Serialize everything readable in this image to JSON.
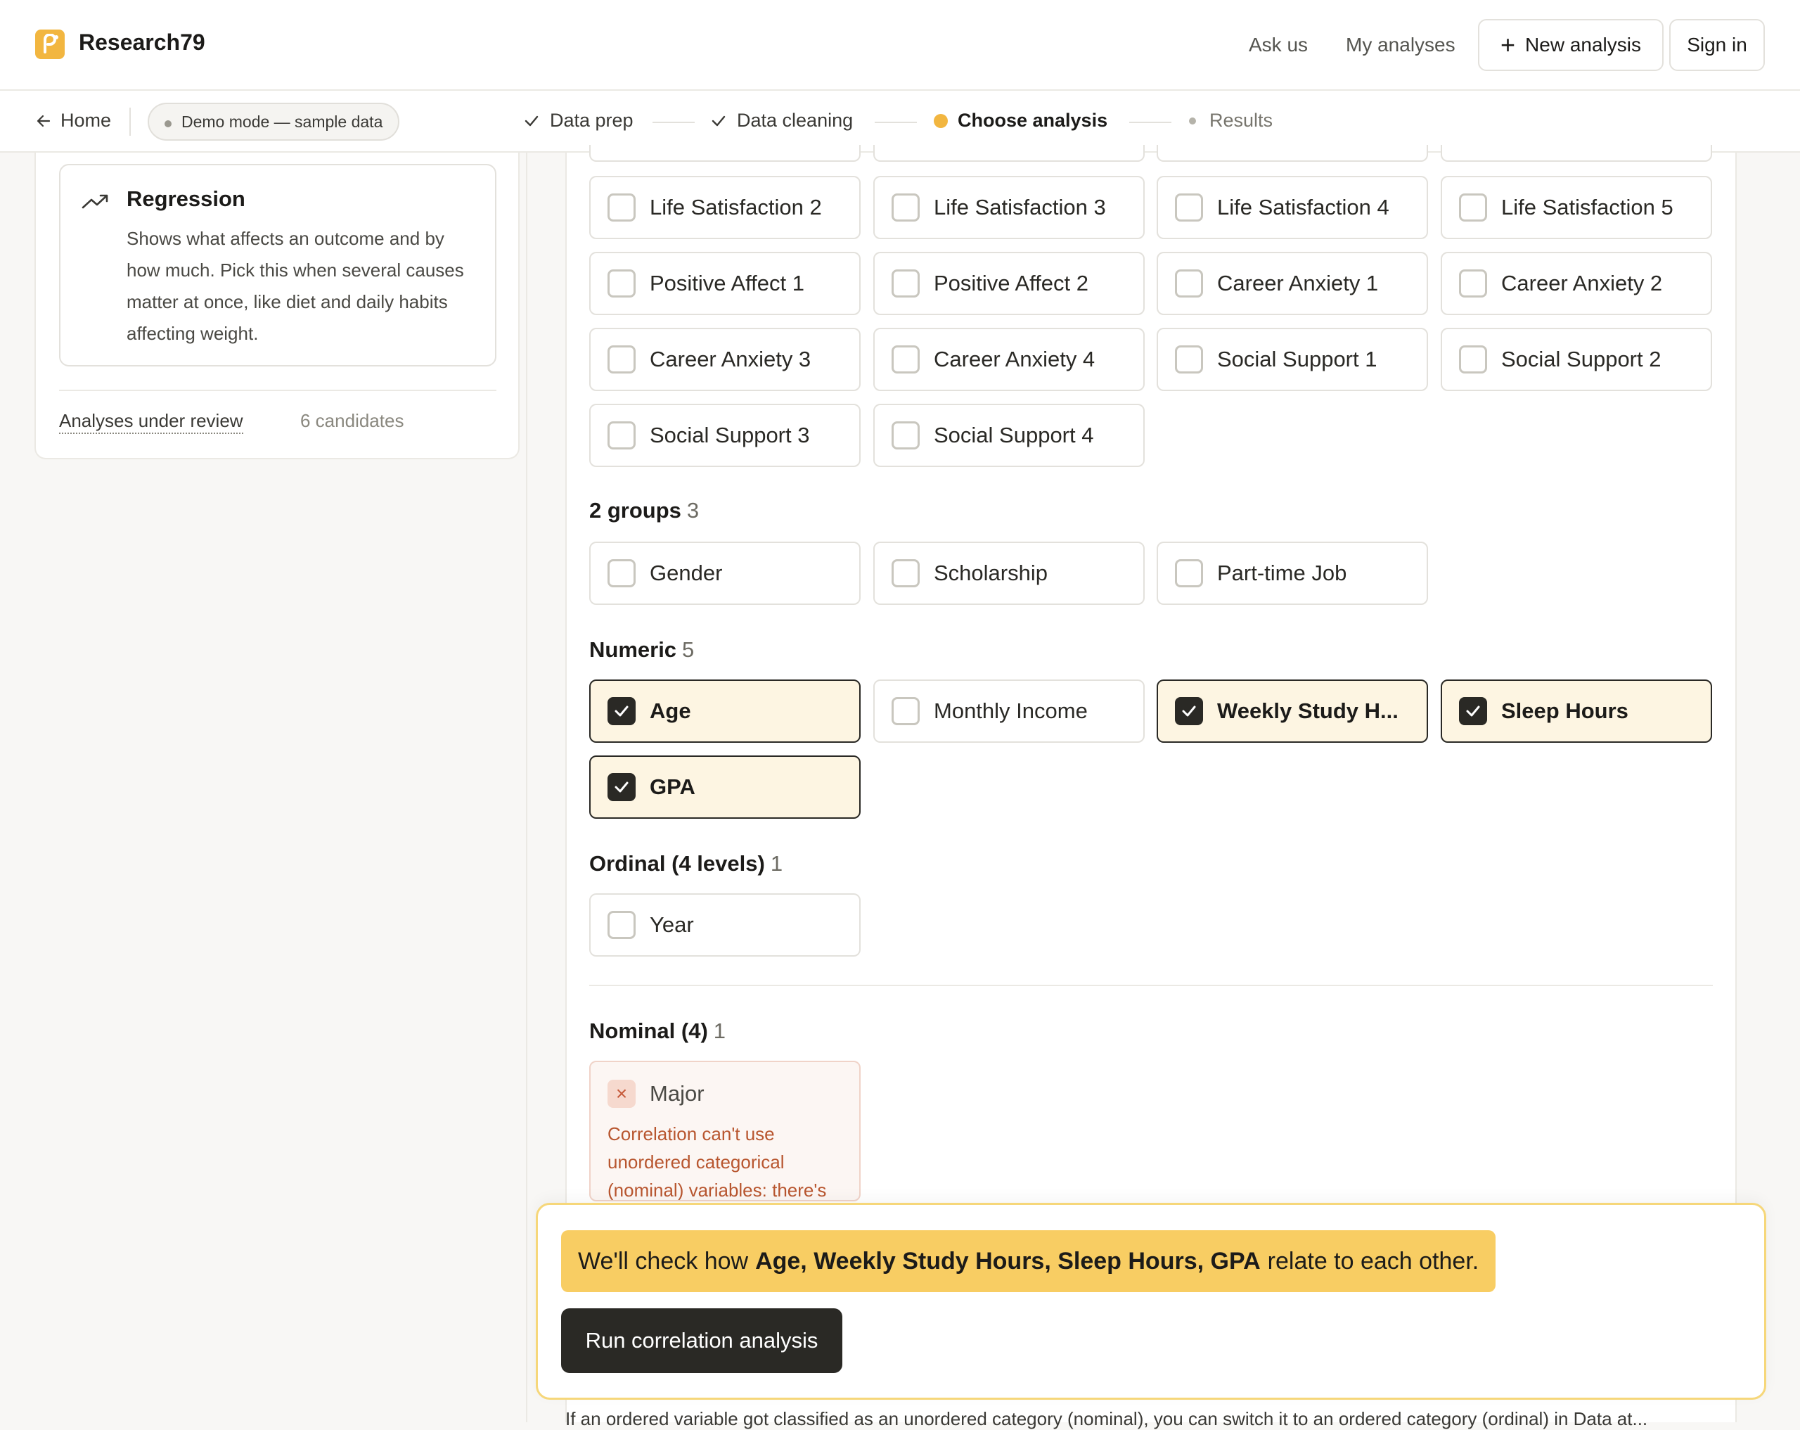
{
  "header": {
    "brand": "Research79",
    "nav_ask": "Ask us",
    "nav_analyses": "My analyses",
    "new_analysis": "New analysis",
    "sign_in": "Sign in"
  },
  "subnav": {
    "back": "Home",
    "demo": "Demo mode — sample data",
    "steps": [
      "Data prep",
      "Data cleaning",
      "Choose analysis",
      "Results"
    ]
  },
  "left": {
    "card_title": "Regression",
    "card_desc": "Shows what affects an outcome and by how much. Pick this when several causes matter at once, like diet and daily habits affecting weight.",
    "review_link": "Analyses under review",
    "review_count": "6 candidates"
  },
  "likert": [
    "Life Satisfaction 2",
    "Life Satisfaction 3",
    "Life Satisfaction 4",
    "Life Satisfaction 5",
    "Positive Affect 1",
    "Positive Affect 2",
    "Career Anxiety 1",
    "Career Anxiety 2",
    "Career Anxiety 3",
    "Career Anxiety 4",
    "Social Support 1",
    "Social Support 2",
    "Social Support 3",
    "Social Support 4"
  ],
  "groups": {
    "two_groups": {
      "title": "2 groups",
      "count": "3",
      "items": [
        "Gender",
        "Scholarship",
        "Part-time Job"
      ]
    },
    "numeric": {
      "title": "Numeric",
      "count": "5",
      "items": [
        "Age",
        "Monthly Income",
        "Weekly Study H...",
        "Sleep Hours",
        "GPA"
      ]
    },
    "ordinal": {
      "title": "Ordinal (4 levels)",
      "count": "1",
      "items": [
        "Year"
      ]
    },
    "nominal": {
      "title": "Nominal (4)",
      "count": "1",
      "item": "Major",
      "error": "Correlation can't use unordered categorical (nominal) variables: there's"
    }
  },
  "action": {
    "summary_pre": "We'll check how",
    "summary_vars": "Age, Weekly Study Hours, Sleep Hours, GPA",
    "summary_post": "relate to each other.",
    "run": "Run correlation analysis"
  },
  "footer_note": "If an ordered variable got classified as an unordered category (nominal), you can switch it to an ordered category (ordinal) in Data at..."
}
